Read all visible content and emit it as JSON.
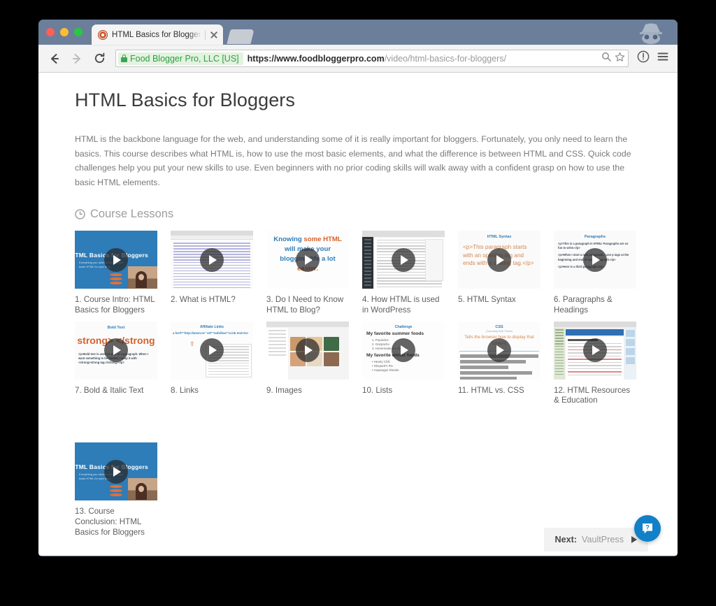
{
  "window": {
    "traffic_lights": [
      "close",
      "minimize",
      "maximize"
    ],
    "incognito_indicator": "incognito-icon"
  },
  "tab": {
    "title": "HTML Basics for Bloggers",
    "favicon": "food-blogger-pro-favicon",
    "close_label": "×",
    "new_tab_label": "+"
  },
  "toolbar": {
    "back_label": "←",
    "forward_label": "→",
    "reload_label": "↻",
    "secure_chip": "Food Blogger Pro, LLC [US]",
    "url_host": "https://www.foodbloggerpro.com",
    "url_path": "/video/html-basics-for-bloggers/",
    "search_icon": "magnifier-icon",
    "bookmark_icon": "star-icon",
    "info_icon": "info-circle-icon",
    "menu_icon": "hamburger-menu-icon"
  },
  "page": {
    "title": "HTML Basics for Bloggers",
    "intro": "HTML is the backbone language for the web, and understanding some of it is really important for bloggers. Fortunately, you only need to learn the basics. This course describes what HTML is, how to use the most basic elements, and what the difference is between HTML and CSS. Quick code challenges help you put your new skills to use. Even beginners with no prior coding skills will walk away with a confident grasp on how to use the basic HTML elements.",
    "section_title": "Course Lessons",
    "section_icon": "clock-icon",
    "play_icon": "play-button-icon",
    "lessons": [
      {
        "caption": "1. Course Intro: HTML Basics for Bloggers",
        "art": "intro",
        "art_text": {
          "headline": "HTML Basics for Bloggers",
          "sub": "Everything you need to know to use basic HTML for your blog"
        }
      },
      {
        "caption": "2. What is HTML?",
        "art": "browser",
        "art_text": {}
      },
      {
        "caption": "3. Do I Need to Know HTML to Blog?",
        "art": "knowing",
        "art_text": {
          "line1": "Knowing",
          "emph1": "some HTML",
          "line2": "will make your",
          "line3": "blogging life a lot",
          "emph2": "easier."
        }
      },
      {
        "caption": "4. How HTML is used in WordPress",
        "art": "wordpress",
        "art_text": {}
      },
      {
        "caption": "5. HTML Syntax",
        "art": "syntax",
        "art_text": {
          "title": "HTML Syntax",
          "body": "<p>This paragraph starts with an opening tag and ends with a closing tag.</p>"
        }
      },
      {
        "caption": "6. Paragraphs & Headings",
        "art": "paragraphs",
        "art_text": {
          "title": "Paragraphs",
          "p1": "<p>This is a paragraph in HTML! Paragraphs are so fun to write.</p>",
          "p2": "<p>When I start a new paragraph, I use p tags at the beginning and end of each paragraph.</p>",
          "p3": "<p>Here is a third paragraph.</p>"
        }
      },
      {
        "caption": "7. Bold & Italic Text",
        "art": "bold",
        "art_text": {
          "title": "Bold Text",
          "big": "strong> </strong",
          "body": "<p>Bold text is used as part of a paragraph. When I want something to be bolded, I wrap it with <strong>strong tag.</strong></p>"
        }
      },
      {
        "caption": "8. Links",
        "art": "links",
        "art_text": {
          "title": "Affiliate Links",
          "code": "a href=\"http://amzn.to\" rel=\"nofollow\">Link text</a>",
          "url": "http://amzn.to"
        }
      },
      {
        "caption": "9. Images",
        "art": "images",
        "art_text": {}
      },
      {
        "caption": "10. Lists",
        "art": "lists",
        "art_text": {
          "title": "Challenge",
          "h1": "My favorite summer foods",
          "items1": "1. Popsicles\n2. Gazpacho\n3. Homemade Ice Cream",
          "h2": "My favorite winter foods",
          "items2": "• Hearty Chili\n• Shepard's Pie\n• Asparagus Risotto"
        }
      },
      {
        "caption": "11. HTML vs. CSS",
        "art": "css",
        "art_text": {
          "title": "CSS",
          "subtitle": "(Cascading Style Sheets)",
          "body": "Tells the browser how to display that content."
        }
      },
      {
        "caption": "12. HTML Resources & Education",
        "art": "resources",
        "art_text": {}
      },
      {
        "caption": "13. Course Conclusion: HTML Basics for Bloggers",
        "art": "intro",
        "art_text": {
          "headline": "HTML Basics for Bloggers",
          "sub": "Everything you need to know to use basic HTML for your blog"
        }
      }
    ],
    "next_button": {
      "prefix": "Next:",
      "target": "VaultPress",
      "arrow_icon": "play-triangle-icon"
    },
    "help_fab": {
      "icon": "help-chat-bubble-icon",
      "glyph": "?"
    }
  },
  "colors": {
    "browser_chrome": "#6b7f9b",
    "secure_green": "#2f9e44",
    "accent_blue": "#2e7cb8",
    "accent_orange": "#d4622c",
    "fab_blue": "#1080c8"
  }
}
